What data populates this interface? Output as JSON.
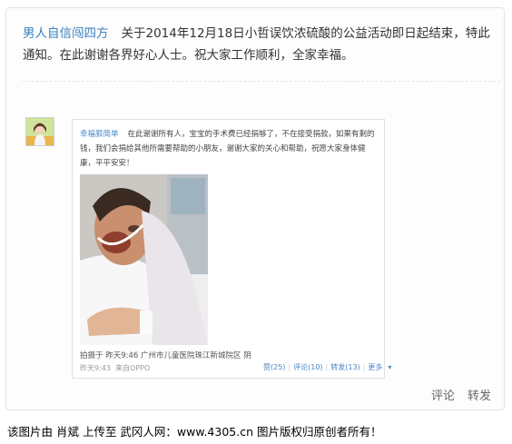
{
  "post": {
    "author": "男人自信闯四方",
    "text": "关于2014年12月18日小哲误饮浓硫酸的公益活动即日起结束，特此通知。在此谢谢各界好心人士。祝大家工作顺利，全家幸福。"
  },
  "embedded": {
    "author": "幸福狠简单",
    "text": "在此谢谢所有人，宝宝的手术费已经捐够了，不在接受捐款，如果有剩的钱，我们会捐给其他所需要帮助的小朋友，谢谢大家的关心和帮助，祝愿大家身体健康，平平安安！",
    "location": "拍摄于 昨天9:46 广州市儿童医院珠江新城院区 阴",
    "time": "昨天9:43",
    "source": "来自OPPO",
    "actions": {
      "like": "赞(25)",
      "comment": "评论(10)",
      "repost": "转发(13)",
      "more": "更多"
    }
  },
  "footer": {
    "comment": "评论",
    "repost": "转发"
  },
  "caption": "该图片由 肖斌 上传至 武冈人网：www.4305.cn 图片版权归原创者所有！",
  "colors": {
    "link": "#3a7fbf",
    "card_border": "#e3e3e3"
  }
}
